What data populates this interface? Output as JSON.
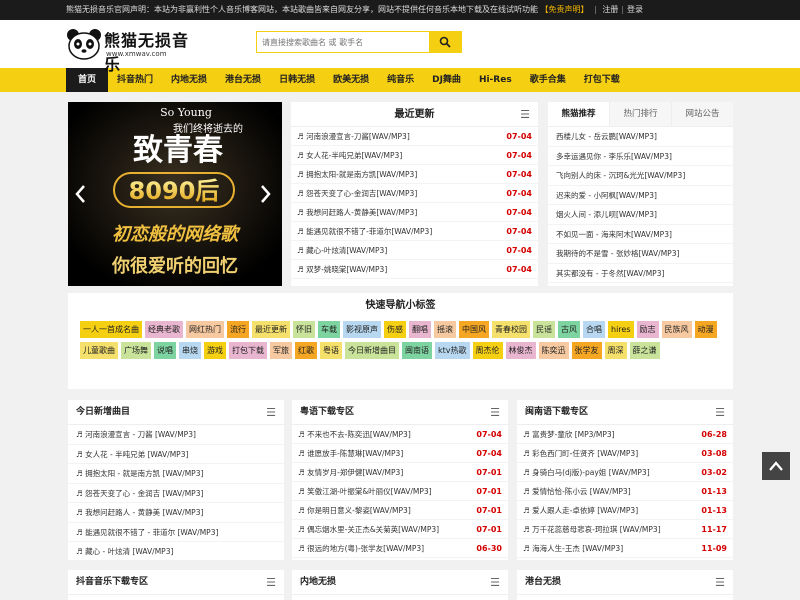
{
  "topbar": {
    "notice": "熊猫无损音乐官网声明：本站为非赢利性个人音乐博客网站，本站歌曲皆来自网友分享，网站不提供任何音乐本地下载及在线试听功能",
    "disclaimer": "【免责声明】",
    "register": "注册",
    "login": "登录"
  },
  "logo": {
    "title": "熊猫无损音乐",
    "url": "www.xmwav.com"
  },
  "search": {
    "placeholder": "请直接搜索歌曲名 或 歌手名",
    "icon": "search-icon"
  },
  "nav": [
    "首页",
    "抖音热门",
    "内地无损",
    "港台无损",
    "日韩无损",
    "欧美无损",
    "纯音乐",
    "DJ舞曲",
    "Hi-Res",
    "歌手合集",
    "打包下载"
  ],
  "banner": {
    "line1": "So Young",
    "line2": "我们终将逝去的",
    "line3": "致青春",
    "line4": "8090后",
    "line5": "初恋般的网络歌",
    "line6": "你很爱听的回忆"
  },
  "latest": {
    "title": "最近更新",
    "items": [
      {
        "t": "♬ 河南浪漫宣言-刀酱[WAV/MP3]",
        "d": "07-04"
      },
      {
        "t": "♬ 女人花-半吨兄弟[WAV/MP3]",
        "d": "07-04"
      },
      {
        "t": "♬ 拥抱太阳-就是南方凯[WAV/MP3]",
        "d": "07-04"
      },
      {
        "t": "♬ 怨苍天变了心-金润吉[WAV/MP3]",
        "d": "07-04"
      },
      {
        "t": "♬ 我想问赶路人-黄静美[WAV/MP3]",
        "d": "07-04"
      },
      {
        "t": "♬ 能遇见就很不错了-菲道尔[WAV/MP3]",
        "d": "07-04"
      },
      {
        "t": "♬ 藏心-叶炫清[WAV/MP3]",
        "d": "07-04"
      },
      {
        "t": "♬ 双梦-姚晓棠[WAV/MP3]",
        "d": "07-04"
      }
    ]
  },
  "right": {
    "tabs": [
      "熊猫推荐",
      "热门排行",
      "网站公告"
    ],
    "items": [
      "西楼儿女 - 岳云鹏[WAV/MP3]",
      "多幸运遇见你 - 李乐乐[WAV/MP3]",
      "飞向别人的床 - 沉珂&光光[WAV/MP3]",
      "迟来的爱 - 小阿枫[WAV/MP3]",
      "烟火人间 - 添儿呗[WAV/MP3]",
      "不如见一面 - 海来阿木[WAV/MP3]",
      "我期待的不是雪 - 张妙格[WAV/MP3]",
      "其实都没有 - 于冬然[WAV/MP3]"
    ]
  },
  "quick": {
    "title": "快速导航小标签",
    "tags": [
      "一人一首成名曲",
      "经典老歌",
      "网红热门",
      "流行",
      "最近更新",
      "怀旧",
      "车载",
      "影视原声",
      "伤感",
      "翻唱",
      "摇滚",
      "中国风",
      "青春校园",
      "民谣",
      "古风",
      "合唱",
      "hires",
      "励志",
      "民族风",
      "动漫",
      "儿童歌曲",
      "广场舞",
      "说唱",
      "串烧",
      "游戏",
      "打包下载",
      "军旅",
      "红歌",
      "粤语",
      "今日新增曲目",
      "闽南语",
      "ktv热歌",
      "周杰伦",
      "林俊杰",
      "陈奕迅",
      "张学友",
      "周深",
      "薛之谦"
    ]
  },
  "col1": {
    "title": "今日新增曲目",
    "items": [
      "♬ 河南浪漫宣言 - 刀酱 [WAV/MP3]",
      "♬ 女人花 - 半吨兄弟 [WAV/MP3]",
      "♬ 拥抱太阳 - 就是南方凯 [WAV/MP3]",
      "♬ 怨苍天变了心 - 金润吉 [WAV/MP3]",
      "♬ 我想问赶路人 - 黄静美 [WAV/MP3]",
      "♬ 能遇见就很不错了 - 菲道尔 [WAV/MP3]",
      "♬ 藏心 - 叶炫清 [WAV/MP3]"
    ]
  },
  "col2": {
    "title": "粤语下载专区",
    "items": [
      {
        "t": "♬ 不来也不去-陈奕迅[WAV/MP3]",
        "d": "07-04"
      },
      {
        "t": "♬ 谁愿放手-陈慧琳[WAV/MP3]",
        "d": "07-04"
      },
      {
        "t": "♬ 友情岁月-郑伊健[WAV/MP3]",
        "d": "07-01"
      },
      {
        "t": "♬ 笑傲江湖-叶振棠&叶丽仪[WAV/MP3]",
        "d": "07-01"
      },
      {
        "t": "♬ 你是明日意义-黎姿[WAV/MP3]",
        "d": "07-01"
      },
      {
        "t": "♬ 偶忘烟水里-关正杰&关菊英[WAV/MP3]",
        "d": "07-01"
      },
      {
        "t": "♬ 很远的地方(粤)-张学友[WAV/MP3]",
        "d": "06-30"
      }
    ]
  },
  "col3": {
    "title": "闽南语下载专区",
    "items": [
      {
        "t": "♬ 富贵梦-童欣 [MP3/MP3]",
        "d": "06-28"
      },
      {
        "t": "♬ 彩色西门町-任贤齐 [WAV/MP3]",
        "d": "03-08"
      },
      {
        "t": "♬ 身骑白马(dj版)-pay姐 [WAV/MP3]",
        "d": "03-02"
      },
      {
        "t": "♬ 爱情恰恰-陈小云 [WAV/MP3]",
        "d": "01-13"
      },
      {
        "t": "♬ 爱人跟人走-卓依婷 [WAV/MP3]",
        "d": "01-13"
      },
      {
        "t": "♬ 万千花蕊慈母悲哀-珂拉琪 [WAV/MP3]",
        "d": "11-17"
      },
      {
        "t": "♬ 海海人生-王杰 [WAV/MP3]",
        "d": "11-09"
      }
    ]
  },
  "bottom": [
    "抖音音乐下载专区",
    "内地无损",
    "港台无损"
  ],
  "colors": {
    "accent": "#f5cf12",
    "dark": "#1b1b1b",
    "date": "#d40000"
  }
}
